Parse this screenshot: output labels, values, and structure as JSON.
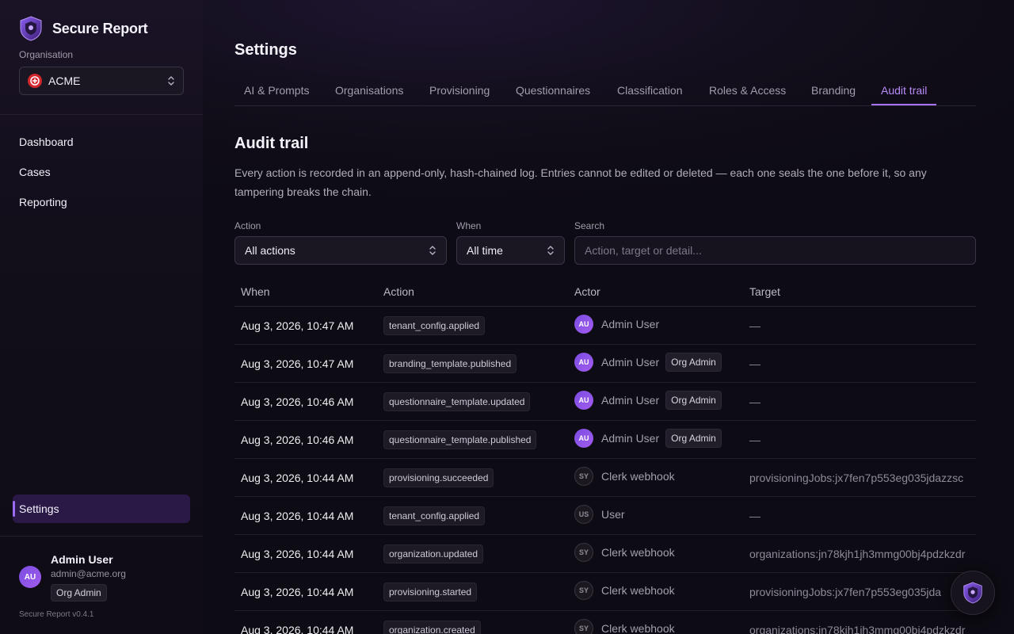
{
  "app": {
    "name": "Secure Report",
    "version": "Secure Report v0.4.1",
    "icon": "shield-logo-icon",
    "accent_color": "#a773f6"
  },
  "sidebar": {
    "org_label": "Organisation",
    "org_selected": "ACME",
    "org_logo_text": "ACME",
    "nav": [
      {
        "label": "Dashboard"
      },
      {
        "label": "Cases"
      },
      {
        "label": "Reporting"
      }
    ],
    "settings_label": "Settings",
    "user": {
      "initials": "AU",
      "name": "Admin User",
      "email": "admin@acme.org",
      "role": "Org Admin"
    }
  },
  "main": {
    "title": "Settings",
    "tabs": [
      {
        "label": "AI & Prompts"
      },
      {
        "label": "Organisations"
      },
      {
        "label": "Provisioning"
      },
      {
        "label": "Questionnaires"
      },
      {
        "label": "Classification"
      },
      {
        "label": "Roles & Access"
      },
      {
        "label": "Branding"
      },
      {
        "label": "Audit trail",
        "active": true
      }
    ],
    "section_title": "Audit trail",
    "section_desc": "Every action is recorded in an append-only, hash-chained log. Entries cannot be edited or deleted — each one seals the one before it, so any tampering breaks the chain.",
    "filters": {
      "action_label": "Action",
      "action_value": "All actions",
      "when_label": "When",
      "when_value": "All time",
      "search_label": "Search",
      "search_placeholder": "Action, target or detail..."
    },
    "table": {
      "headers": {
        "when": "When",
        "action": "Action",
        "actor": "Actor",
        "target": "Target"
      },
      "rows": [
        {
          "when": "Aug 3, 2026, 10:47 AM",
          "action": "tenant_config.applied",
          "actor_initials": "AU",
          "actor": "Admin User",
          "role": "",
          "target": "—"
        },
        {
          "when": "Aug 3, 2026, 10:47 AM",
          "action": "branding_template.published",
          "actor_initials": "AU",
          "actor": "Admin User",
          "role": "Org Admin",
          "target": "—"
        },
        {
          "when": "Aug 3, 2026, 10:46 AM",
          "action": "questionnaire_template.updated",
          "actor_initials": "AU",
          "actor": "Admin User",
          "role": "Org Admin",
          "target": "—"
        },
        {
          "when": "Aug 3, 2026, 10:46 AM",
          "action": "questionnaire_template.published",
          "actor_initials": "AU",
          "actor": "Admin User",
          "role": "Org Admin",
          "target": "—"
        },
        {
          "when": "Aug 3, 2026, 10:44 AM",
          "action": "provisioning.succeeded",
          "actor_initials": "SY",
          "actor": "Clerk webhook",
          "role": "",
          "target": "provisioningJobs:jx7fen7p553eg035jdazzsc"
        },
        {
          "when": "Aug 3, 2026, 10:44 AM",
          "action": "tenant_config.applied",
          "actor_initials": "US",
          "actor": "User",
          "role": "",
          "target": "—"
        },
        {
          "when": "Aug 3, 2026, 10:44 AM",
          "action": "organization.updated",
          "actor_initials": "SY",
          "actor": "Clerk webhook",
          "role": "",
          "target": "organizations:jn78kjh1jh3mmg00bj4pdzkzdr"
        },
        {
          "when": "Aug 3, 2026, 10:44 AM",
          "action": "provisioning.started",
          "actor_initials": "SY",
          "actor": "Clerk webhook",
          "role": "",
          "target": "provisioningJobs:jx7fen7p553eg035jda"
        },
        {
          "when": "Aug 3, 2026, 10:44 AM",
          "action": "organization.created",
          "actor_initials": "SY",
          "actor": "Clerk webhook",
          "role": "",
          "target": "organizations:jn78kjh1jh3mmg00bj4pdzkzdr"
        }
      ]
    }
  }
}
